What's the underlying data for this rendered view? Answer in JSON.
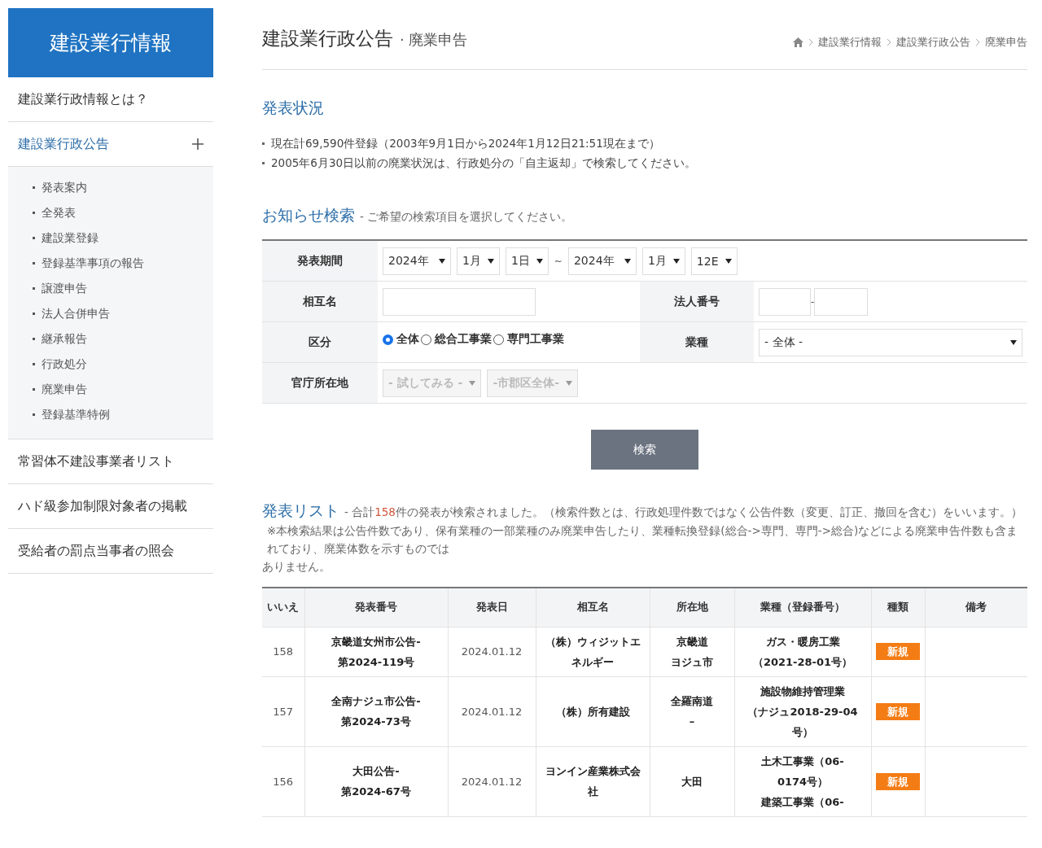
{
  "sidebar": {
    "title": "建設業行情報",
    "items": [
      {
        "label": "建設業行政情報とは？",
        "selected": false
      },
      {
        "label": "建設業行政公告",
        "selected": true,
        "children": [
          {
            "label": "発表案内"
          },
          {
            "label": "全発表"
          },
          {
            "label": "建設業登録"
          },
          {
            "label": "登録基準事項の報告"
          },
          {
            "label": "譲渡申告"
          },
          {
            "label": "法人合併申告"
          },
          {
            "label": "継承報告"
          },
          {
            "label": "行政処分"
          },
          {
            "label": "廃業申告"
          },
          {
            "label": "登録基準特例"
          }
        ]
      },
      {
        "label": "常習体不建設事業者リスト",
        "selected": false
      },
      {
        "label": "ハド級参加制限対象者の掲載",
        "selected": false
      },
      {
        "label": "受給者の罰点当事者の照会",
        "selected": false
      }
    ]
  },
  "header": {
    "title": "建設業行政公告",
    "subtitle": "· 廃業申告",
    "breadcrumb": [
      "建設業行情報",
      "建設業行政公告",
      "廃業申告"
    ]
  },
  "status": {
    "heading": "発表状況",
    "notes": [
      "現在計69,590件登録（2003年9月1日から2024年1月12日21:51現在まで）",
      "2005年6月30日以前の廃業状況は、行政処分の「自主返却」で検索してください。"
    ]
  },
  "search": {
    "heading": "お知らせ検索",
    "hint": "- ご希望の検索項目を選択してください。",
    "period": {
      "label": "発表期間",
      "from": [
        "2024年",
        "1月",
        "1日"
      ],
      "separator": "~",
      "to": [
        "2024年",
        "1月",
        "12E"
      ]
    },
    "name": {
      "label": "相互名"
    },
    "corp_number": {
      "label": "法人番号",
      "separator": "-"
    },
    "category": {
      "label": "区分",
      "options": [
        {
          "label": "全体",
          "selected": true
        },
        {
          "label": "総合工事業",
          "selected": false
        },
        {
          "label": "専門工事業",
          "selected": false
        }
      ]
    },
    "industry": {
      "label": "業種",
      "value": "- 全体 -"
    },
    "office": {
      "label": "官庁所在地",
      "selects": [
        {
          "value": "- 試してみる -",
          "disabled": true
        },
        {
          "value": "-市郡区全体-",
          "disabled": true
        }
      ]
    },
    "button": "検索"
  },
  "list": {
    "heading": "発表リスト",
    "summary_before": "- 合計",
    "count": "158",
    "summary_after": "件の発表が検索されました。（検索件数とは、行政処理件数ではなく公告件数（変更、訂正、撤回を含む）をいいます。）",
    "notes": [
      "※本検索結果は公告件数であり、保有業種の一部業種のみ廃業申告したり、業種転換登録(総合->専門、専門->総合)などによる廃業申告件数も含まれており、廃業体数を示すものでは",
      "ありません。"
    ]
  },
  "table": {
    "columns": [
      "いいえ",
      "発表番号",
      "発表日",
      "相互名",
      "所在地",
      "業種（登録番号）",
      "種類",
      "備考"
    ],
    "rows": [
      {
        "no": "158",
        "number": [
          "京畿道女州市公告-",
          "第2024-119号"
        ],
        "date": "2024.01.12",
        "name": [
          "（株）ウィジットエ",
          "ネルギー"
        ],
        "location": [
          "京畿道",
          "ヨジュ市"
        ],
        "industry": [
          "ガス・暖房工業",
          "（2021-28-01号）"
        ],
        "type": "新規"
      },
      {
        "no": "157",
        "number": [
          "全南ナジュ市公告-",
          "第2024-73号"
        ],
        "date": "2024.01.12",
        "name": [
          "（株）所有建設"
        ],
        "location": [
          "全羅南道",
          "–"
        ],
        "industry": [
          "施設物維持管理業",
          "（ナジュ2018-29-04",
          "号）"
        ],
        "type": "新規"
      },
      {
        "no": "156",
        "number": [
          "大田公告-",
          "第2024-67号"
        ],
        "date": "2024.01.12",
        "name": [
          "ヨンイン産業株式会",
          "社"
        ],
        "location": [
          "大田"
        ],
        "industry": [
          "土木工事業（06-",
          "0174号）",
          "建築工事業（06-"
        ],
        "type": "新規"
      }
    ]
  }
}
